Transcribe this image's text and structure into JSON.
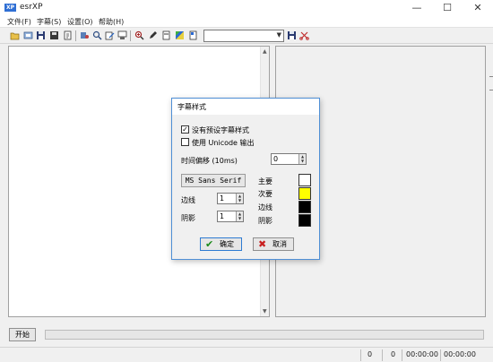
{
  "window": {
    "title": "esrXP",
    "app_icon_text": "XP"
  },
  "menu": [
    "文件(F)",
    "字幕(S)",
    "设置(O)",
    "帮助(H)"
  ],
  "toolbar": {
    "icons": [
      "open-folder-icon",
      "open-file-icon",
      "save-icon",
      "save-as-icon",
      "file-info-icon",
      "ocr-icon",
      "search-icon",
      "edit-icon",
      "stamp-icon",
      "zoom-icon",
      "pen-icon",
      "page-icon",
      "color-icon",
      "document-icon"
    ],
    "style_select_value": "",
    "apply_icon": "save-icon",
    "clear_icon": "scissors-icon"
  },
  "bottom": {
    "start_label": "开始",
    "progress": 0
  },
  "status": {
    "count1": "0",
    "count2": "0",
    "time1": "00:00:00",
    "time2": "00:00:00"
  },
  "dialog": {
    "title": "字幕样式",
    "no_preset_label": "没有预设字幕样式",
    "no_preset_checked": true,
    "unicode_label": "使用 Unicode 输出",
    "unicode_checked": false,
    "offset_label": "时间偏移 (10ms)",
    "offset_value": "0",
    "font_button_label": "MS Sans Serif",
    "outline_label": "边线",
    "outline_value": "1",
    "shadow_label": "阴影",
    "shadow_value": "1",
    "colors": [
      {
        "label": "主要",
        "color": "#ffffff"
      },
      {
        "label": "次要",
        "color": "#ffff00"
      },
      {
        "label": "边线",
        "color": "#000000"
      },
      {
        "label": "阴影",
        "color": "#000000"
      }
    ],
    "ok_label": "确定",
    "cancel_label": "取消"
  }
}
